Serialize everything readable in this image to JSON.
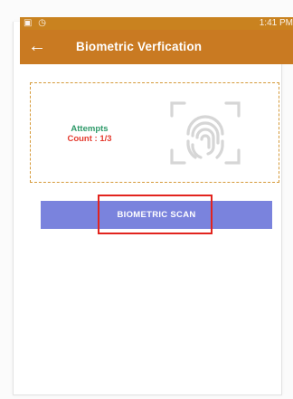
{
  "status_bar": {
    "time": "1:41 PM"
  },
  "appbar": {
    "back_icon": "arrow-left-icon",
    "title": "Biometric Verfication"
  },
  "card": {
    "attempts_label": "Attempts",
    "count_label": "Count : 1/3",
    "fingerprint_icon": "fingerprint-icon"
  },
  "scan_button": {
    "label": "BIOMETRIC SCAN"
  },
  "colors": {
    "appbar": "#c97a22",
    "card_border": "#d59a3a",
    "attempts_text": "#2f9a6a",
    "count_text": "#e43b2f",
    "button": "#7a83dd",
    "highlight": "#e2241e"
  }
}
